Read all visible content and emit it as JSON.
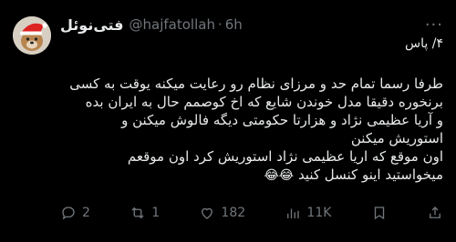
{
  "tweet": {
    "display_name": "فتی‌نوئل",
    "handle": "@hajfatollah",
    "separator": "·",
    "time": "6h",
    "more": "···",
    "reply_to": "۴/ پاس",
    "lines": [
      "طرفا رسما تمام حد و مرزای نظام رو رعایت میکنه یوقت به کسی",
      "برنخوره دقیقا مدل خوندن شایع که اخ کوصمم حال به ایران بده",
      "و آریا عظیمی نژاد و هزارتا حکومتی دیگه فالوش میکنن و",
      "استوریش میکنن",
      "اون موقع که اریا عظیمی نژاد استوریش کرد اون موقعم",
      "میخواستید اینو کنسل کنید"
    ],
    "emoji": "😂😂"
  },
  "actions": {
    "replies": "2",
    "retweets": "1",
    "likes": "182",
    "views": "11K"
  }
}
